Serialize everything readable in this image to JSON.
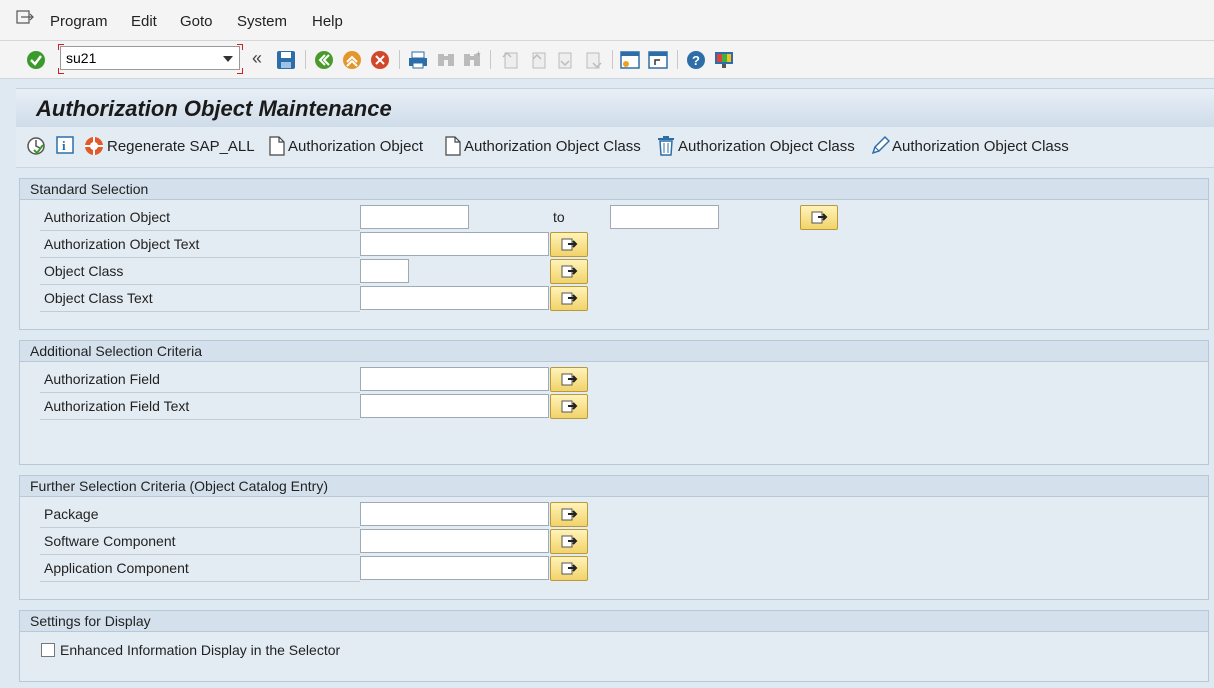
{
  "menu": {
    "program": "Program",
    "edit": "Edit",
    "goto": "Goto",
    "system": "System",
    "help": "Help"
  },
  "toolbar": {
    "command_value": "su21",
    "icons": [
      "enter-icon",
      "save-icon",
      "back-icon",
      "exit-icon",
      "cancel-icon",
      "print-icon",
      "find-icon",
      "find-next-icon",
      "first-page-icon",
      "previous-page-icon",
      "next-page-icon",
      "last-page-icon",
      "new-session-icon",
      "shortcut-icon",
      "help-icon",
      "customize-layout-icon"
    ]
  },
  "title": "Authorization Object Maintenance",
  "app_toolbar": {
    "regenerate": "Regenerate SAP_ALL",
    "create_object": "Authorization Object",
    "create_class": "Authorization Object Class",
    "delete_class": "Authorization Object Class",
    "change_class": "Authorization Object Class"
  },
  "standard_selection": {
    "title": "Standard Selection",
    "auth_object": "Authorization Object",
    "to": "to",
    "auth_object_text": "Authorization Object Text",
    "object_class": "Object Class",
    "object_class_text": "Object Class Text"
  },
  "additional_selection": {
    "title": "Additional Selection Criteria",
    "auth_field": "Authorization Field",
    "auth_field_text": "Authorization Field Text"
  },
  "further_selection": {
    "title": "Further Selection Criteria (Object Catalog Entry)",
    "package": "Package",
    "software_component": "Software Component",
    "application_component": "Application Component"
  },
  "display_settings": {
    "title": "Settings for Display",
    "enhanced_info": "Enhanced Information Display in the Selector"
  },
  "colors": {
    "background": "#dfe9f2",
    "multi_select_button": "#f2d36a",
    "group_header": "#d4e1ed"
  }
}
